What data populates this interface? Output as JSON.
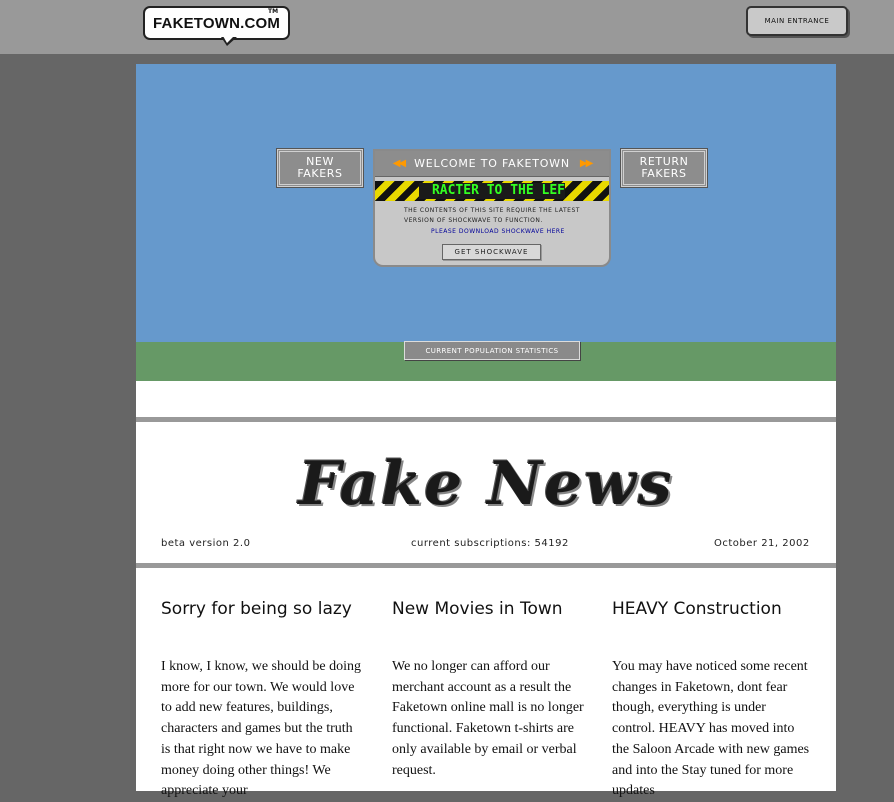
{
  "header": {
    "logo_text": "FAKETOWN.COM",
    "logo_tm": "TM",
    "main_entrance_label": "MAIN ENTRANCE"
  },
  "hero": {
    "new_fakers_line1": "NEW",
    "new_fakers_line2": "FAKERS",
    "return_fakers_line1": "RETURN",
    "return_fakers_line2": "FAKERS",
    "welcome_label": "WELCOME TO FAKETOWN",
    "ticker_text": "RACTER TO THE LEF",
    "plugin_notice_line1": "THE CONTENTS OF THIS SITE REQUIRE THE LATEST",
    "plugin_notice_line2": "VERSION OF SHOCKWAVE TO FUNCTION.",
    "plugin_link": "PLEASE DOWNLOAD SHOCKWAVE HERE",
    "get_button": "GET SHOCKWAVE",
    "stats_button": "CURRENT POPULATION STATISTICS"
  },
  "newsletter": {
    "title": "Fake News",
    "version": "beta version 2.0",
    "subscriptions": "current subscriptions: 54192",
    "date": "October 21, 2002"
  },
  "articles": [
    {
      "title": "Sorry for being so lazy",
      "body": "I know, I know, we should be doing more for our town. We would love to add new features, buildings, characters and games but the truth is that right now we have to make money doing other things! We appreciate your"
    },
    {
      "title": "New Movies in Town",
      "body": "We no longer can afford our merchant account as a result the Faketown online mall is no longer functional. Faketown t-shirts are only available by email or verbal request."
    },
    {
      "title": "HEAVY Construction",
      "body": "You may have noticed some recent changes in Faketown, dont fear though, everything is under control. HEAVY has moved into the Saloon Arcade with new games and into the Stay tuned for more updates"
    }
  ],
  "colors": {
    "page_bg": "#666666",
    "topbar": "#999999",
    "sky": "#6699cc",
    "grass": "#669966",
    "ticker_text": "#33ff22",
    "hazard_yellow": "#e8d800",
    "arrow_orange": "#ff9900"
  }
}
